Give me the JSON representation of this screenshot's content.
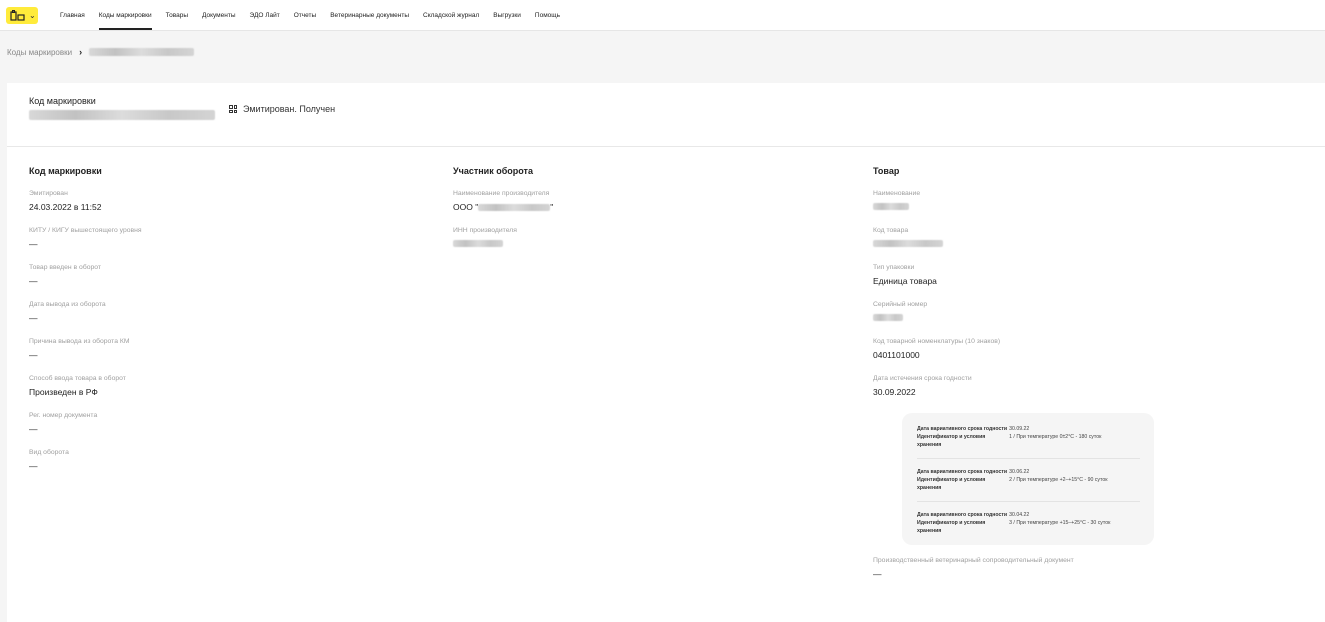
{
  "nav": {
    "items": [
      {
        "label": "Главная"
      },
      {
        "label": "Коды маркировки"
      },
      {
        "label": "Товары"
      },
      {
        "label": "Документы"
      },
      {
        "label": "ЭДО Лайт"
      },
      {
        "label": "Отчеты"
      },
      {
        "label": "Ветеринарные документы"
      },
      {
        "label": "Складской журнал"
      },
      {
        "label": "Выгрузки"
      },
      {
        "label": "Помощь"
      }
    ],
    "active_index": 1
  },
  "breadcrumb": {
    "root": "Коды маркировки",
    "separator": "›"
  },
  "header": {
    "code_label": "Код маркировки",
    "status": "Эмитирован. Получен"
  },
  "col1": {
    "title": "Код маркировки",
    "fields": [
      {
        "label": "Эмитирован",
        "value": "24.03.2022 в 11:52"
      },
      {
        "label": "КИТУ / КИГУ вышестоящего уровня",
        "value": "—"
      },
      {
        "label": "Товар введен в оборот",
        "value": "—"
      },
      {
        "label": "Дата вывода из оборота",
        "value": "—"
      },
      {
        "label": "Причина вывода из оборота КМ",
        "value": "—"
      },
      {
        "label": "Способ ввода товара в оборот",
        "value": "Произведен в РФ"
      },
      {
        "label": "Рег. номер документа",
        "value": "—"
      },
      {
        "label": "Вид оборота",
        "value": "—"
      }
    ]
  },
  "col2": {
    "title": "Участник оборота",
    "fields": [
      {
        "label": "Наименование производителя",
        "value_prefix": "ООО \"",
        "value_suffix": "\""
      },
      {
        "label": "ИНН производителя"
      }
    ]
  },
  "col3": {
    "title": "Товар",
    "fields": [
      {
        "label": "Наименование"
      },
      {
        "label": "Код товара"
      },
      {
        "label": "Тип упаковки",
        "value": "Единица товара"
      },
      {
        "label": "Серийный номер"
      },
      {
        "label": "Код товарной номенклатуры (10 знаков)",
        "value": "0401101000"
      },
      {
        "label": "Дата истечения срока годности",
        "value": "30.09.2022"
      }
    ],
    "variants": [
      {
        "date_label": "Дата вариативного срока годности",
        "date": "30.09.22",
        "cond_label": "Идентификатор и условия хранения",
        "cond": "1 / При температуре 0±2°С - 180 суток"
      },
      {
        "date_label": "Дата вариативного срока годности",
        "date": "30.06.22",
        "cond_label": "Идентификатор и условия хранения",
        "cond": "2 / При температуре +2–+15°С - 90 суток"
      },
      {
        "date_label": "Дата вариативного срока годности",
        "date": "30.04.22",
        "cond_label": "Идентификатор и условия хранения",
        "cond": "3 / При температуре +15–+25°С - 30 суток"
      }
    ],
    "vet_doc": {
      "label": "Производственный ветеринарный сопроводительный документ",
      "value": "—"
    }
  },
  "colors": {
    "logo_bg": "#ffeb3b",
    "page_bg": "#f5f5f5",
    "panel_bg": "#ffffff",
    "label": "#a0a0a0"
  }
}
